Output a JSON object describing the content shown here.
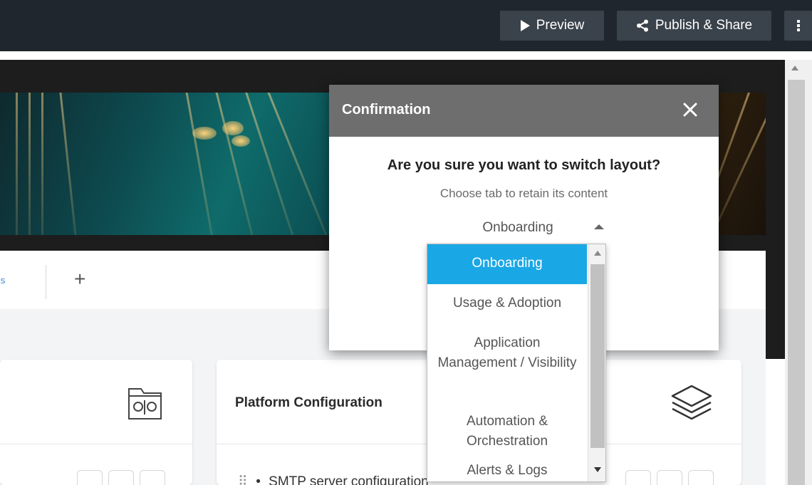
{
  "toolbar": {
    "preview_label": "Preview",
    "publish_label": "Publish & Share",
    "icons": {
      "preview": "play-icon",
      "publish": "share-icon",
      "more": "more-vertical-icon"
    }
  },
  "tabs": {
    "add_label": "+"
  },
  "cards": {
    "right_title": "Platform Configuration",
    "right_row": "SMTP server configuration",
    "icons": {
      "left": "settings-folder-icon",
      "right": "layers-icon"
    }
  },
  "modal": {
    "title": "Confirmation",
    "question": "Are you sure you want to switch layout?",
    "subtitle": "Choose tab to retain its content",
    "selected_value": "Onboarding",
    "close_icon": "close-icon"
  },
  "dropdown": {
    "items": [
      {
        "label": "Onboarding",
        "selected": true
      },
      {
        "label": "Usage & Adoption",
        "selected": false
      },
      {
        "label": "Application Management / Visibility",
        "selected": false
      },
      {
        "label": "Automation & Orchestration",
        "selected": false
      },
      {
        "label": "Alerts & Logs",
        "selected": false
      }
    ]
  },
  "colors": {
    "toolbar_bg": "#1f262e",
    "toolbar_button": "#3a424b",
    "modal_header": "#6e6e6e",
    "selected_item": "#1aa7e5"
  }
}
